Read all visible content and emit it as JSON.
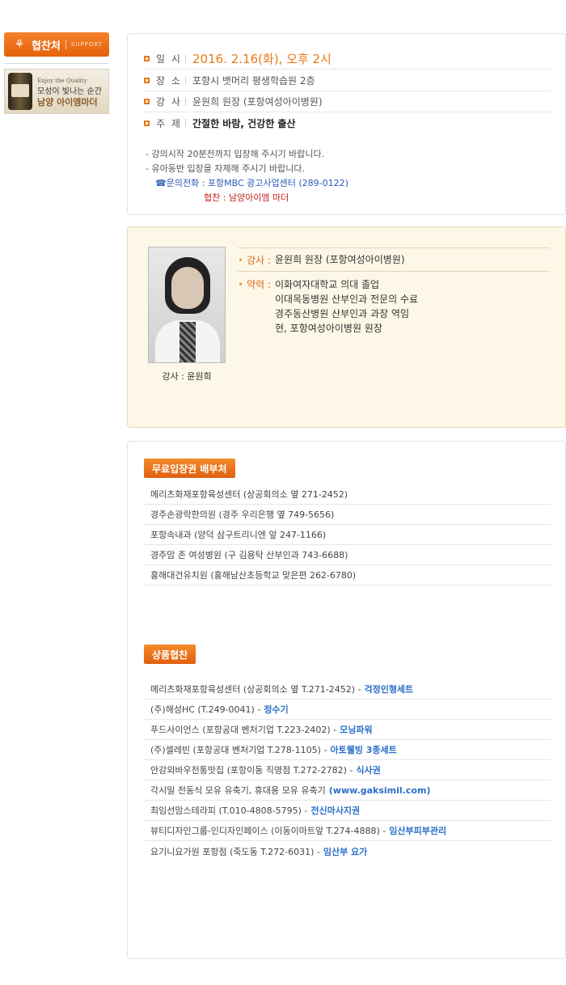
{
  "sidebar": {
    "support_label": "협찬처",
    "support_sub": "SUPPORT",
    "banner_en": "Enjoy the Quality",
    "banner_line1": "모성이 빛나는 순간",
    "banner_line2": "남양 아이엠마더"
  },
  "event": {
    "rows": [
      {
        "label": "일 시",
        "value": "2016. 2.16(화), 오후 2시"
      },
      {
        "label": "장 소",
        "value": "포항시 뱃머리 평생학습원 2층"
      },
      {
        "label": "강 사",
        "value": "윤원희 원장 (포항여성아이병원)"
      },
      {
        "label": "주 제",
        "value": "간절한 바람, 건강한 출산"
      }
    ],
    "note1": "- 강의시작 20분전까지 입장해 주시기 바랍니다.",
    "note2": "- 유아동반 입장을 자제해 주시기 바랍니다.",
    "contact": "☎문의전화 : 포항MBC 광고사업센터 (289-0122)",
    "sponsor": "협찬 : 남양아이엠 마더"
  },
  "lecturer": {
    "photo_caption": "강사 : 윤원희",
    "name_key": "강사 :",
    "name_value": "윤원희 원장 (포항여성아이병원)",
    "career_key": "약력 :",
    "career": [
      "이화여자대학교 의대 졸업",
      "이대목동병원 산부인과 전문의 수료",
      "경주동산병원 산부인과 과장 역임",
      "현, 포항여성아이병원 원장"
    ]
  },
  "tickets": {
    "title": "무료입장권 배부처",
    "items": [
      "메리츠화재포항육성센터 (상공회의소 옆 271-2452)",
      "경주손광락한의원 (경주 우리은행 옆 749-5656)",
      "포항속내과 (양덕 삼구트리니엔 앞 247-1166)",
      "경주맘 존 여성병원 (구 김용탁 산부인과 743-6688)",
      "홍해대건유치원 (홍해남산초등학교 맞은편 262-6780)"
    ]
  },
  "products": {
    "title": "상품협찬",
    "items": [
      {
        "text": "메리츠화재포항육성센터 (상공회의소 옆 T.271-2452) -",
        "product": "걱정인형세트"
      },
      {
        "text": "(주)해성HC (T.249-0041) -",
        "product": "정수기"
      },
      {
        "text": "푸드사이언스 (포항공대 벤처기업 T.223-2402) -",
        "product": "모닝파워"
      },
      {
        "text": "(주)셀레빈 (포항공대 벤처기업 T.278-1105) -",
        "product": "아토웰빙 3종세트"
      },
      {
        "text": "안강외바우전통맛집 (포항이동 직영점 T.272-2782) -",
        "product": "식사권"
      },
      {
        "text": "각시밀 전동식 모유 유축기, 휴대용 모유 유축기",
        "product": "(www.gaksimil.com)"
      },
      {
        "text": "최임선맘스테라피 (T.010-4808-5795) -",
        "product": "전신마사지권"
      },
      {
        "text": "뷰티디자인그룹-인디자인페이스 (이동이마트앞 T.274-4888) -",
        "product": "임산부피부관리"
      },
      {
        "text": "요기니요가원 포항점 (죽도동 T.272-6031) -",
        "product": "임산부 요가"
      }
    ]
  }
}
